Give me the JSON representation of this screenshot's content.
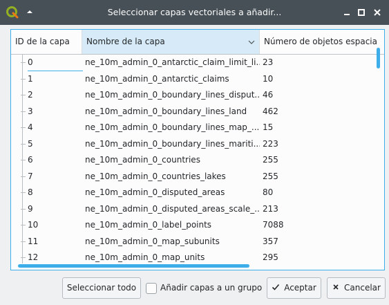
{
  "window": {
    "title": "Seleccionar capas vectoriales a añadir..."
  },
  "icons": {
    "app": "qgis-logo-icon",
    "keep_above": "chevron-up-icon",
    "minimize": "minimize-icon",
    "maximize": "maximize-icon",
    "close": "close-icon",
    "sort": "chevron-down-icon",
    "accept": "checkmark-icon",
    "cancel": "x-icon"
  },
  "colors": {
    "accent": "#3daee9",
    "titlebar": "#475057",
    "sorted_header": "#d6ebf7",
    "qgis_green": "#93b023"
  },
  "table": {
    "headers": {
      "id": "ID de la capa",
      "name": "Nombre de la capa",
      "count": "Número de objetos espacia"
    },
    "rows": [
      {
        "id": "0",
        "name": "ne_10m_admin_0_antarctic_claim_limit_li...",
        "count": "23"
      },
      {
        "id": "1",
        "name": "ne_10m_admin_0_antarctic_claims",
        "count": "10"
      },
      {
        "id": "2",
        "name": "ne_10m_admin_0_boundary_lines_disput...",
        "count": "46"
      },
      {
        "id": "3",
        "name": "ne_10m_admin_0_boundary_lines_land",
        "count": "462"
      },
      {
        "id": "4",
        "name": "ne_10m_admin_0_boundary_lines_map_...",
        "count": "15"
      },
      {
        "id": "5",
        "name": "ne_10m_admin_0_boundary_lines_mariti...",
        "count": "223"
      },
      {
        "id": "6",
        "name": "ne_10m_admin_0_countries",
        "count": "255"
      },
      {
        "id": "7",
        "name": "ne_10m_admin_0_countries_lakes",
        "count": "255"
      },
      {
        "id": "8",
        "name": "ne_10m_admin_0_disputed_areas",
        "count": "80"
      },
      {
        "id": "9",
        "name": "ne_10m_admin_0_disputed_areas_scale_...",
        "count": "213"
      },
      {
        "id": "10",
        "name": "ne_10m_admin_0_label_points",
        "count": "7088"
      },
      {
        "id": "11",
        "name": "ne_10m_admin_0_map_subunits",
        "count": "357"
      },
      {
        "id": "12",
        "name": "ne_10m_admin_0_map_units",
        "count": "295"
      }
    ]
  },
  "buttons": {
    "select_all": "Seleccionar todo",
    "add_to_group": "Añadir capas a un grupo",
    "accept": "Aceptar",
    "cancel": "Cancelar"
  }
}
